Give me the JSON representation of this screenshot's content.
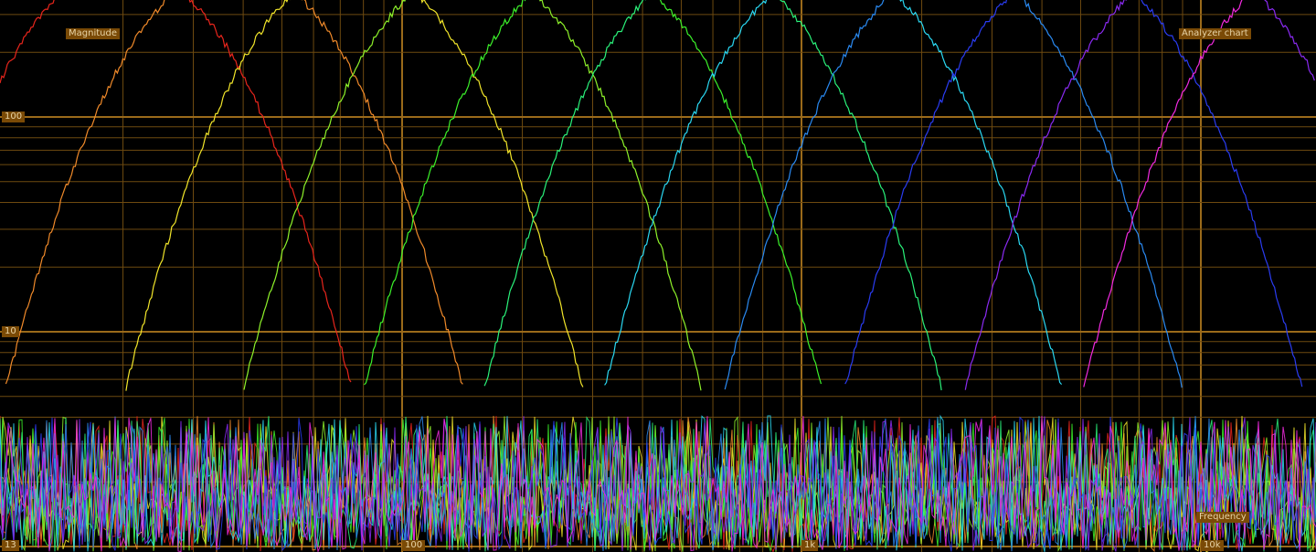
{
  "chart_data": {
    "type": "line",
    "title": "Analyzer chart",
    "xlabel": "Frequency",
    "ylabel": "Magnitude",
    "x_scale": "log",
    "y_scale": "log",
    "xlim": [
      13,
      22050
    ],
    "ylim": [
      1,
      700
    ],
    "grid": true,
    "y_tick_labels": [
      {
        "value": 100,
        "label": "100"
      },
      {
        "value": 10,
        "label": "10"
      }
    ],
    "x_tick_labels": [
      {
        "value": 13,
        "label": "13"
      },
      {
        "value": 100,
        "label": "100"
      },
      {
        "value": 1000,
        "label": "1k"
      },
      {
        "value": 10000,
        "label": "10k"
      }
    ],
    "series": [
      {
        "color": "#e8251c",
        "peak_freq": 20,
        "peak_mag": 500
      },
      {
        "color": "#f08a2a",
        "peak_freq": 38,
        "peak_mag": 500
      },
      {
        "color": "#f2e62a",
        "peak_freq": 76,
        "peak_mag": 500
      },
      {
        "color": "#8ef22a",
        "peak_freq": 150,
        "peak_mag": 500
      },
      {
        "color": "#3cf22a",
        "peak_freq": 300,
        "peak_mag": 500
      },
      {
        "color": "#2af27a",
        "peak_freq": 600,
        "peak_mag": 500
      },
      {
        "color": "#2ad8f2",
        "peak_freq": 1200,
        "peak_mag": 500
      },
      {
        "color": "#2a8af2",
        "peak_freq": 2400,
        "peak_mag": 500
      },
      {
        "color": "#2a3cf2",
        "peak_freq": 4800,
        "peak_mag": 500
      },
      {
        "color": "#8a2af2",
        "peak_freq": 9600,
        "peak_mag": 500
      },
      {
        "color": "#f22ae0",
        "peak_freq": 19000,
        "peak_mag": 500
      }
    ]
  }
}
